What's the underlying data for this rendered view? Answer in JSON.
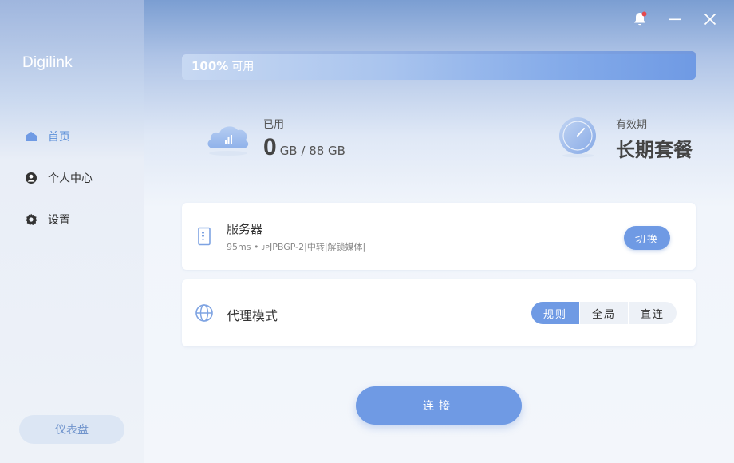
{
  "app": {
    "brand": "Digilink"
  },
  "sidebar": {
    "items": [
      {
        "label": "首页",
        "icon": "home-icon",
        "active": true
      },
      {
        "label": "个人中心",
        "icon": "user-icon",
        "active": false
      },
      {
        "label": "设置",
        "icon": "gear-icon",
        "active": false
      }
    ],
    "dashboard_label": "仪表盘"
  },
  "titlebar": {
    "bell_icon": "bell-icon",
    "minimize_icon": "minimize-icon",
    "close_icon": "close-icon",
    "notification_dot": true
  },
  "usage": {
    "percent_text": "100%",
    "suffix": "可用",
    "fraction": 1.0
  },
  "stats": {
    "used_label": "已用",
    "used_value": "0",
    "used_unit": "GB / 88 GB",
    "validity_label": "有效期",
    "validity_value": "长期套餐"
  },
  "server": {
    "title": "服务器",
    "detail": "95ms • ᴊᴘJPBGP-2|中转|解锁媒体|",
    "switch_label": "切换"
  },
  "proxy": {
    "title": "代理模式",
    "modes": [
      "规则",
      "全局",
      "直连"
    ],
    "selected": "规则"
  },
  "connect_label": "连接",
  "colors": {
    "accent": "#6f9ae4",
    "active_nav": "#5b8fd9",
    "notification": "#e5484d"
  }
}
